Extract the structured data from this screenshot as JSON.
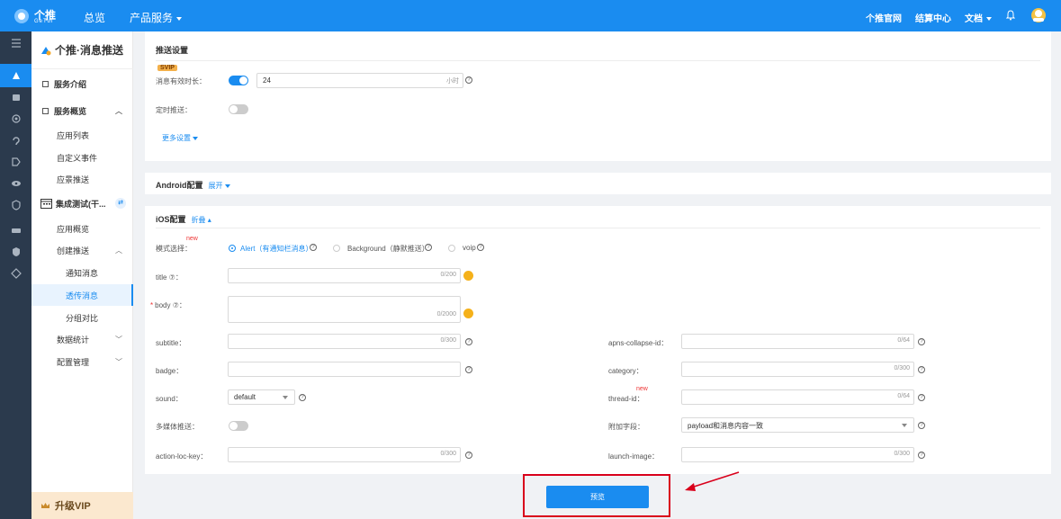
{
  "topbar": {
    "logo_text": "个推",
    "logo_sub": "GeTuI",
    "nav_overview": "总览",
    "nav_products": "产品服务",
    "link_official": "个推官网",
    "link_billing": "结算中心",
    "link_docs": "文档",
    "bell_icon": "bell-icon",
    "avatar_icon": "avatar-icon"
  },
  "rail": {
    "icons": [
      "menu-icon",
      "push-icon",
      "robot-icon",
      "fingerprint-icon",
      "ear-icon",
      "tag-icon",
      "eye-icon",
      "shield-icon",
      "card-icon",
      "security-icon",
      "diamond-icon"
    ]
  },
  "sidebar": {
    "title": "个推·消息推送",
    "items": [
      {
        "label": "服务介绍"
      },
      {
        "label": "服务概览"
      },
      {
        "label": "应用列表"
      },
      {
        "label": "自定义事件"
      },
      {
        "label": "应景推送"
      },
      {
        "label": "集成测试(干..."
      },
      {
        "label": "应用概览"
      },
      {
        "label": "创建推送"
      },
      {
        "label": "通知消息"
      },
      {
        "label": "透传消息"
      },
      {
        "label": "分组对比"
      },
      {
        "label": "数据统计"
      },
      {
        "label": "配置管理"
      }
    ],
    "vip": "升级VIP"
  },
  "push_settings": {
    "title": "推送设置",
    "svip": "SVIP",
    "validity_label": "消息有效时长：",
    "validity_value": "24",
    "validity_unit": "小时",
    "validity_on": true,
    "timed_label": "定时推送：",
    "timed_on": false,
    "more": "更多设置"
  },
  "android": {
    "title": "Android配置",
    "expand": "展开"
  },
  "ios": {
    "title": "iOS配置",
    "collapse": "折叠",
    "new_tag": "new",
    "mode_label": "模式选择：",
    "modes": [
      "Alert（有通知栏消息）",
      "Background（静默推送）",
      "voip"
    ],
    "title_label": "title ⑦：",
    "title_count": "0/200",
    "body_label": "body ⑦：",
    "body_count": "0/2000",
    "subtitle_label": "subtitle：",
    "subtitle_count": "0/300",
    "apns_label": "apns-collapse-id：",
    "apns_count": "0/64",
    "badge_label": "badge：",
    "category_label": "category：",
    "category_count": "0/300",
    "sound_label": "sound：",
    "sound_value": "default",
    "thread_label": "thread-id：",
    "thread_count": "0/64",
    "multimedia_label": "多媒体推送：",
    "multimedia_on": false,
    "extra_label": "附加字段：",
    "extra_value": "payload和消息内容一致",
    "action_label": "action-loc-key：",
    "action_count": "0/300",
    "launch_label": "launch-image：",
    "launch_count": "0/300"
  },
  "footer": {
    "preview": "预览"
  }
}
